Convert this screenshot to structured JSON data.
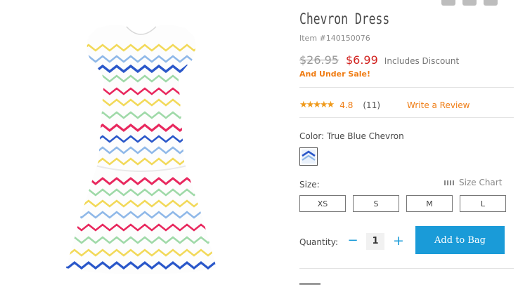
{
  "product": {
    "title": "Chevron Dress",
    "item_number": "Item #140150076",
    "price_old": "$26.95",
    "price_new": "$6.99",
    "discount_note": "Includes Discount",
    "sale_note": "And Under Sale!"
  },
  "rating": {
    "stars": "★★★★★",
    "value": "4.8",
    "count": "(11)",
    "write_review": "Write a Review"
  },
  "color": {
    "label": "Color: True Blue Chevron"
  },
  "size": {
    "label": "Size:",
    "chart_link": "Size Chart",
    "options": [
      "XS",
      "S",
      "M",
      "L"
    ]
  },
  "quantity": {
    "label": "Quantity:",
    "minus": "−",
    "value": "1",
    "plus": "+"
  },
  "cart": {
    "add_label": "Add to Bag"
  },
  "colors": {
    "accent": "#1a9bd8",
    "sale_red": "#d1211e",
    "orange": "#ef7d15"
  }
}
